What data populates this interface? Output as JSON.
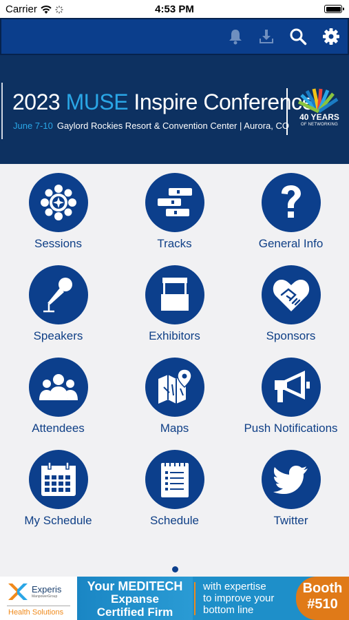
{
  "status_bar": {
    "carrier": "Carrier",
    "time": "4:53 PM"
  },
  "toolbar": {
    "icons": [
      "bell-icon",
      "download-icon",
      "search-icon",
      "gear-icon"
    ]
  },
  "banner": {
    "title_year": "2023 ",
    "title_accent": "MUSE",
    "title_rest": " Inspire Conference",
    "dates": "June 7-10",
    "venue": "Gaylord Rockies Resort & Convention Center | Aurora, CO",
    "logo_big": "40 YEARS",
    "logo_small": "OF NETWORKING"
  },
  "tiles": [
    {
      "label": "Sessions",
      "icon": "sessions-icon"
    },
    {
      "label": "Tracks",
      "icon": "tracks-icon"
    },
    {
      "label": "General Info",
      "icon": "question-icon"
    },
    {
      "label": "Speakers",
      "icon": "microphone-icon"
    },
    {
      "label": "Exhibitors",
      "icon": "booth-icon"
    },
    {
      "label": "Sponsors",
      "icon": "handshake-heart-icon"
    },
    {
      "label": "Attendees",
      "icon": "people-icon"
    },
    {
      "label": "Maps",
      "icon": "map-pin-icon"
    },
    {
      "label": "Push Notifications",
      "icon": "megaphone-icon"
    },
    {
      "label": "My Schedule",
      "icon": "calendar-icon"
    },
    {
      "label": "Schedule",
      "icon": "checklist-icon"
    },
    {
      "label": "Twitter",
      "icon": "twitter-bird-icon"
    }
  ],
  "ad": {
    "brand": "Experis",
    "brand_sub": "ManpowerGroup",
    "division": "Health Solutions",
    "headline_1": "Your MEDITECH",
    "headline_2": "Expanse",
    "headline_3": "Certified Firm",
    "tagline_1": "with expertise",
    "tagline_2": "to improve your",
    "tagline_3": "bottom line",
    "booth_1": "Booth",
    "booth_2": "#510"
  },
  "colors": {
    "primary": "#0c3f8c",
    "banner": "#0d3161",
    "accent": "#2aa6e6",
    "orange": "#e07a18"
  }
}
